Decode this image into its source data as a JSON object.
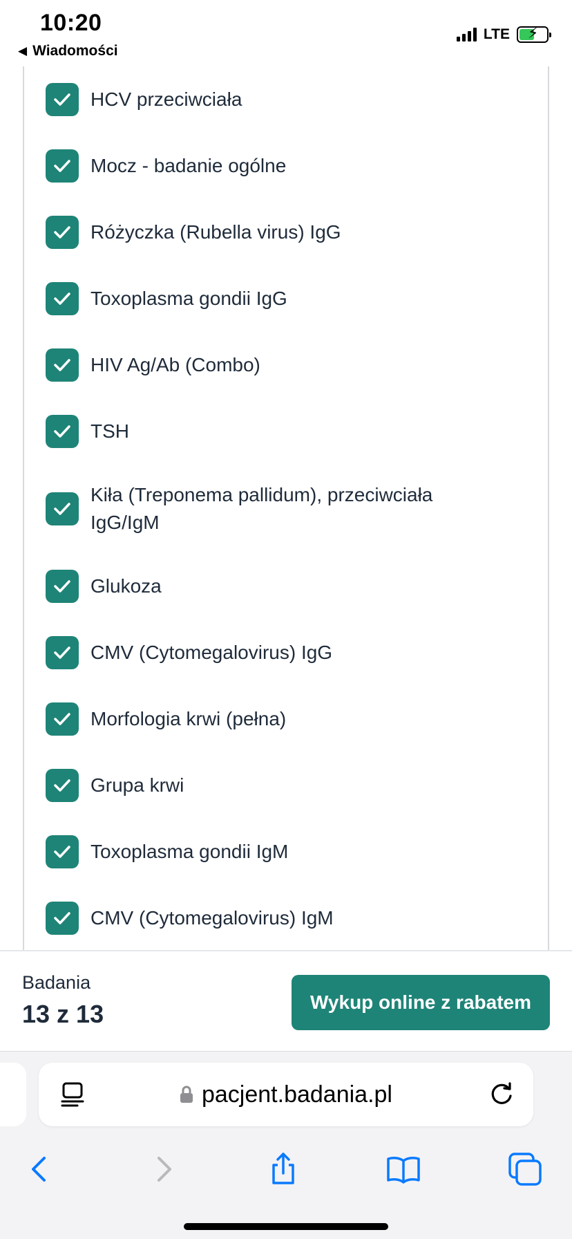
{
  "status_bar": {
    "time": "10:20",
    "back_app": "Wiadomości",
    "network": "LTE",
    "battery_level": 0.55
  },
  "tests": [
    {
      "label": "HCV przeciwciała",
      "checked": true
    },
    {
      "label": "Mocz - badanie ogólne",
      "checked": true
    },
    {
      "label": "Różyczka (Rubella virus) IgG",
      "checked": true
    },
    {
      "label": "Toxoplasma gondii IgG",
      "checked": true
    },
    {
      "label": "HIV Ag/Ab (Combo)",
      "checked": true
    },
    {
      "label": "TSH",
      "checked": true
    },
    {
      "label": "Kiła (Treponema pallidum), przeciwciała IgG/IgM",
      "checked": true
    },
    {
      "label": "Glukoza",
      "checked": true
    },
    {
      "label": "CMV (Cytomegalovirus) IgG",
      "checked": true
    },
    {
      "label": "Morfologia krwi (pełna)",
      "checked": true
    },
    {
      "label": "Grupa krwi",
      "checked": true
    },
    {
      "label": "Toxoplasma gondii IgM",
      "checked": true
    },
    {
      "label": "CMV (Cytomegalovirus) IgM",
      "checked": true
    }
  ],
  "summary": {
    "label": "Badania",
    "count": "13 z 13",
    "buy_label": "Wykup online z rabatem"
  },
  "browser": {
    "url": "pacjent.badania.pl"
  },
  "icons": {
    "checkbox": "check-icon",
    "reader": "reader-mode-icon",
    "lock": "lock-icon",
    "reload": "reload-icon",
    "back": "chevron-left-icon",
    "forward": "chevron-right-icon",
    "share": "share-icon",
    "bookmarks": "book-icon",
    "tabs": "tabs-icon"
  },
  "colors": {
    "accent": "#1e8477",
    "browser_blue": "#0a7aff",
    "text": "#1f2b3a"
  }
}
